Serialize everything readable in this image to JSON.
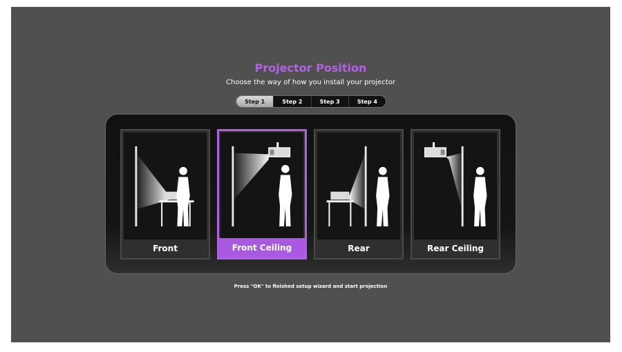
{
  "screen": {
    "title": "Projector Position",
    "subtitle": "Choose the way of how you install your projector",
    "hint": "Press \"OK\" to finished setup wizard and start projection"
  },
  "steps": [
    {
      "label": "Step 1",
      "active": true
    },
    {
      "label": "Step 2",
      "active": false
    },
    {
      "label": "Step 3",
      "active": false
    },
    {
      "label": "Step 4",
      "active": false
    }
  ],
  "options": [
    {
      "label": "Front",
      "icon": "front-table-projection-icon",
      "selected": false
    },
    {
      "label": "Front Ceiling",
      "icon": "front-ceiling-projection-icon",
      "selected": true
    },
    {
      "label": "Rear",
      "icon": "rear-table-projection-icon",
      "selected": false
    },
    {
      "label": "Rear Ceiling",
      "icon": "rear-ceiling-projection-icon",
      "selected": false
    }
  ],
  "colors": {
    "accent": "#b15fe6",
    "background": "#505050",
    "panel": "#111111"
  }
}
